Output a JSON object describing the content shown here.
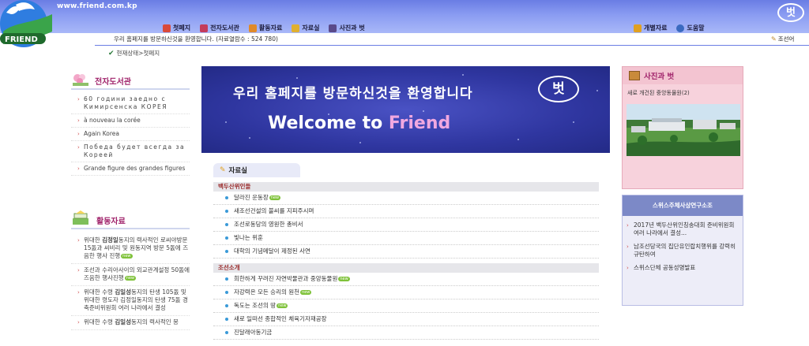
{
  "header": {
    "url": "www.friend.com.kp",
    "logo_text": "FRIEND",
    "brand_mark": "벗",
    "nav": [
      {
        "label": "첫페지",
        "icon": "home-icon",
        "color": "#d94a3a"
      },
      {
        "label": "전자도서관",
        "icon": "book-icon",
        "color": "#c43c5c"
      },
      {
        "label": "활동자료",
        "icon": "activity-icon",
        "color": "#e08a2a"
      },
      {
        "label": "자료실",
        "icon": "archive-icon",
        "color": "#e0b030"
      },
      {
        "label": "사진과 벗",
        "icon": "camera-icon",
        "color": "#5a4a8a"
      }
    ],
    "nav_right": [
      {
        "label": "개별자료",
        "icon": "document-icon",
        "color": "#e0a020"
      },
      {
        "label": "도움말",
        "icon": "help-icon",
        "color": "#3a6ac0"
      }
    ]
  },
  "subbar": {
    "welcome": "우리 홈페지를 방문하신것을 환영합니다.",
    "views": "(자료열람수 : 524 780)",
    "language": "조선어"
  },
  "breadcrumb": "현재상태>첫페지",
  "ebook": {
    "title": "전자도서관",
    "items": [
      "60 години заедно с Кимирсенска КОРЕЯ",
      "à nouveau la corée",
      "Again Korea",
      "Победа будет всегда за Кореей",
      "Grande figure des grandes figures"
    ]
  },
  "activity": {
    "title": "활동자료",
    "items": [
      {
        "prefix": "위대한 ",
        "bold": "김정일",
        "suffix": "동지의 력사적인 로씨야방문 15돐과 씨비리 및 원동지역 방문 5돐에 즈음한 행사 진행",
        "new": true
      },
      {
        "prefix": "",
        "bold": "",
        "suffix": "조선과 수리아사이의 외교관계설정 50돐에 즈음한 행사진행",
        "new": true
      },
      {
        "prefix": "위대한 수령 ",
        "bold": "김일성",
        "suffix": "동지의 탄생 105돐 및 위대한 령도자 김정일동지의 탄생 75돐 경축준비위원회 여러 나라에서 결성",
        "new": false
      },
      {
        "prefix": "위대한 수령 ",
        "bold": "김일성",
        "suffix": "동지의 력사적인 몽",
        "new": false
      }
    ]
  },
  "banner": {
    "korean": "우리 홈페지를 방문하신것을 환영합니다",
    "english_prefix": "Welcome to ",
    "english_highlight": "Friend",
    "mark": "벗"
  },
  "archive": {
    "title": "자료실",
    "categories": [
      {
        "name": "백두산위인들",
        "items": [
          {
            "text": "달라진 운동장",
            "new": true
          },
          {
            "text": "새조선건설의 불씨를 지피주시며",
            "new": false
          },
          {
            "text": "조선로동당의 영원한 총비서",
            "new": false
          },
          {
            "text": "빛나는 위훈",
            "new": false
          },
          {
            "text": "대학의 기념메달이 제정된 사연",
            "new": false
          }
        ]
      },
      {
        "name": "조선소개",
        "items": [
          {
            "text": "희한하게 꾸려진 자연박물관과 중앙동물원",
            "new": true
          },
          {
            "text": "자강력은 모든 승리의 원천",
            "new": true
          },
          {
            "text": "독도는 조선의 땅",
            "new": true
          },
          {
            "text": "새로 일떠선 종합적인 체육기자재공장",
            "new": false
          },
          {
            "text": "진달래아동기금",
            "new": false
          }
        ]
      }
    ]
  },
  "photo": {
    "title": "사진과 벗",
    "caption": "새로 개건된 중앙동물원(2)"
  },
  "juche": {
    "title": "스위스주체사상연구소조",
    "items": [
      "2017년 백두산위인칭송대회 준비위원회 여러 나라에서 결성...",
      "남조선당국의 집단유인랍치행위를 강력히 규탄하여",
      "스위스단체 공동성명발표"
    ]
  }
}
